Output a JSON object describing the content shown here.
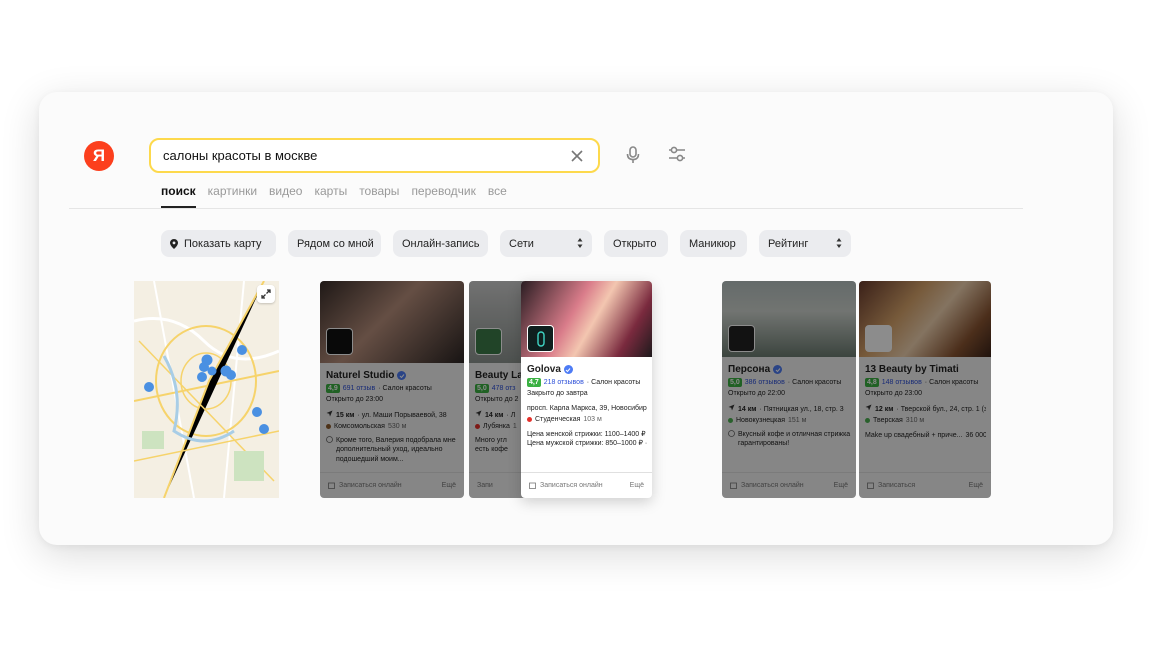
{
  "logo": "Я",
  "search": {
    "query": "салоны красоты в москве"
  },
  "tabs": [
    "поиск",
    "картинки",
    "видео",
    "карты",
    "товары",
    "переводчик",
    "все"
  ],
  "filters": {
    "show_map": "Показать карту",
    "nearby": "Рядом со мной",
    "online_booking": "Онлайн-запись",
    "chains": "Сети",
    "open": "Открыто",
    "manicure": "Маникюр",
    "rating": "Рейтинг"
  },
  "colors": {
    "brand_red": "#fc3f1d",
    "search_border": "#fdd94c",
    "rating_green": "#3bb143",
    "reviews_blue": "#2c4fd8",
    "metro_red": "#e4312b",
    "metro_brown": "#8d5b2d",
    "metro_green": "#4caf50"
  },
  "cards": [
    {
      "name": "Naturel Studio",
      "rating": "4,9",
      "reviews": "691 отзыв",
      "category": "· Салон красоты",
      "hours": "Открыто до 23:00",
      "distance": "15 км",
      "address": "· ул. Маши Порываевой, 38",
      "metro": "Комсомольская",
      "metro_dist": "530 м",
      "review_text": "Кроме того, Валерия подобрала мне дополнительный уход, идеально подошедший моим...",
      "book": "Записаться онлайн",
      "more": "Ещё"
    },
    {
      "name": "Beauty La",
      "rating": "5,0",
      "reviews": "478 отз",
      "hours": "Открыто до 2",
      "distance": "14 км",
      "address": "· Л",
      "metro": "Лубянка",
      "metro_dist": "1",
      "review_text": "Много угл есть кофе",
      "book": "Запи",
      "more": ""
    },
    {
      "name": "Golova",
      "rating": "4,7",
      "reviews": "218 отзывов",
      "category": "· Салон красоты",
      "hours": "Закрыто до завтра",
      "address": "просп. Карла Маркса, 39, Новосибир...",
      "metro": "Студенческая",
      "metro_dist": "103 м",
      "price_1": "Цена женской стрижки: 1100–1400 ₽ ·",
      "price_2": "Цена мужской стрижки: 850–1000 ₽ ·...",
      "book": "Записаться онлайн",
      "more": "Ещё"
    },
    {
      "name": "Персона",
      "rating": "5,0",
      "reviews": "386 отзывов",
      "category": "· Салон красоты",
      "hours": "Открыто до 22:00",
      "distance": "14 км",
      "address": "· Пятницкая ул., 18, стр. 3",
      "metro": "Новокузнецкая",
      "metro_dist": "151 м",
      "review_text": "Вкусный кофе и отличная стрижка гарантированы!",
      "book": "Записаться онлайн",
      "more": "Ещё"
    },
    {
      "name": "13 Beauty by Timati",
      "rating": "4,8",
      "reviews": "148 отзывов",
      "category": "· Салон красоты",
      "hours": "Открыто до 23:00",
      "distance": "12 км",
      "address": "· Тверской бул., 24, стр. 1 (з...",
      "metro": "Тверская",
      "metro_dist": "310 м",
      "service": "Make up свадебный + приче...",
      "service_price": "36 000 ₽",
      "book": "Записаться",
      "more": "Ещё"
    }
  ]
}
